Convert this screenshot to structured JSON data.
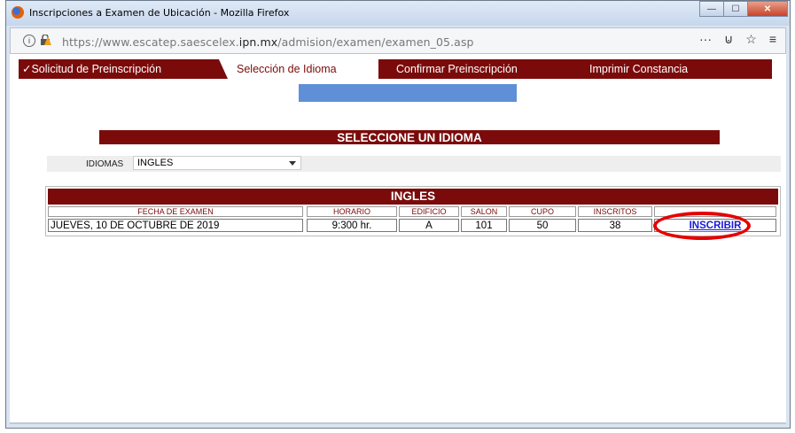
{
  "window": {
    "title": "Inscripciones a Examen de Ubicación - Mozilla Firefox",
    "buttons": {
      "minimize": "—",
      "maximize": "☐",
      "close": "✕"
    }
  },
  "address_bar": {
    "url_prefix": "https://www.escatep.saescelex.",
    "url_domain": "ipn.mx",
    "url_path": "/admision/examen/examen_05.asp",
    "icons": [
      "info-icon",
      "lock-icon",
      "more-icon",
      "pocket-icon",
      "star-icon",
      "menu-icon"
    ]
  },
  "tabs": [
    {
      "label": "✓Solicitud de Preinscripción",
      "active": false
    },
    {
      "label": "Selección de Idioma",
      "active": true
    },
    {
      "label": "Confirmar Preinscripción",
      "active": false
    },
    {
      "label": "Imprimir Constancia",
      "active": false
    }
  ],
  "section": {
    "title": "SELECCIONE UN IDIOMA"
  },
  "idiomas": {
    "label": "IDIOMAS",
    "selected": "INGLES"
  },
  "table": {
    "title": "INGLES",
    "headers": [
      "FECHA DE EXAMEN",
      "HORARIO",
      "EDIFICIO",
      "SALON",
      "CUPO",
      "INSCRITOS",
      ""
    ],
    "rows": [
      {
        "fecha": "JUEVES, 10 DE OCTUBRE DE 2019",
        "horario": "9:300 hr.",
        "edificio": "A",
        "salon": "101",
        "cupo": "50",
        "inscritos": "38",
        "accion": "INSCRIBIR"
      }
    ]
  },
  "colors": {
    "brand": "#7b0b0b",
    "highlight": "#e60000",
    "link": "#1a1ad6",
    "banner": "#5f8fd6"
  }
}
